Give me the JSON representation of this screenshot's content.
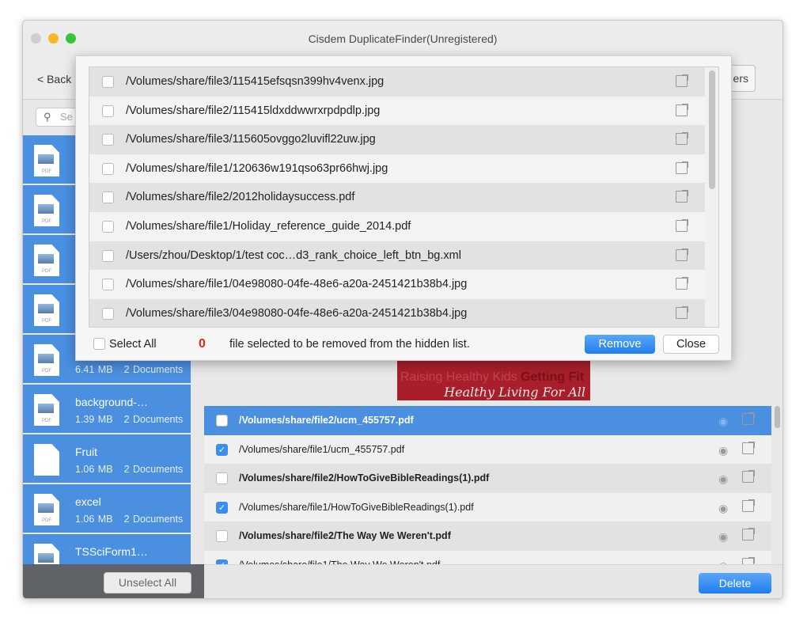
{
  "window": {
    "title": "Cisdem DuplicateFinder(Unregistered)"
  },
  "toolbar": {
    "back_label": "< Back",
    "right_button_label": "ers"
  },
  "sidebar": {
    "search_placeholder": "Se",
    "items": [
      {
        "name": "",
        "size": "",
        "count": "",
        "icon": "pdf-file-icon"
      },
      {
        "name": "",
        "size": "",
        "count": "",
        "icon": "pdf-file-icon"
      },
      {
        "name": "",
        "size": "",
        "count": "",
        "icon": "pdf-file-icon"
      },
      {
        "name": "",
        "size": "",
        "count": "",
        "icon": "pdf-file-icon"
      },
      {
        "name": "",
        "size": "6.41 MB",
        "count": "2 Documents",
        "icon": "pdf-file-icon"
      },
      {
        "name": "background-…",
        "size": "1.39 MB",
        "count": "2 Documents",
        "icon": "pdf-file-icon"
      },
      {
        "name": "Fruit",
        "size": "1.06 MB",
        "count": "2 Documents",
        "icon": "blank-file-icon"
      },
      {
        "name": "excel",
        "size": "1.06 MB",
        "count": "2 Documents",
        "icon": "pdf-file-icon"
      },
      {
        "name": "TSSciForm1…",
        "size": "",
        "count": "",
        "icon": "pdf-file-icon"
      }
    ],
    "unselect_all_label": "Unselect All"
  },
  "preview": {
    "line1_a": "Raising Healthy Kids ",
    "line1_b": "Getting Fit",
    "line2": "Healthy Living For All"
  },
  "main_list": [
    {
      "path": "/Volumes/share/file2/ucm_455757.pdf",
      "checked": false,
      "bold": true,
      "selected": true
    },
    {
      "path": "/Volumes/share/file1/ucm_455757.pdf",
      "checked": true,
      "bold": false,
      "selected": false
    },
    {
      "path": "/Volumes/share/file2/HowToGiveBibleReadings(1).pdf",
      "checked": false,
      "bold": true,
      "selected": false
    },
    {
      "path": "/Volumes/share/file1/HowToGiveBibleReadings(1).pdf",
      "checked": true,
      "bold": false,
      "selected": false
    },
    {
      "path": "/Volumes/share/file2/The Way We Weren't.pdf",
      "checked": false,
      "bold": true,
      "selected": false
    },
    {
      "path": "/Volumes/share/file1/The Way We Weren't.pdf",
      "checked": true,
      "bold": false,
      "selected": false
    }
  ],
  "delete_label": "Delete",
  "dialog": {
    "items": [
      "/Volumes/share/file3/115415efsqsn399hv4venx.jpg",
      "/Volumes/share/file2/115415ldxddwwrxrpdpdlp.jpg",
      "/Volumes/share/file3/115605ovggo2luvifl22uw.jpg",
      "/Volumes/share/file1/120636w191qso63pr66hwj.jpg",
      "/Volumes/share/file2/2012holidaysuccess.pdf",
      "/Volumes/share/file1/Holiday_reference_guide_2014.pdf",
      "/Users/zhou/Desktop/1/test coc…d3_rank_choice_left_btn_bg.xml",
      "/Volumes/share/file1/04e98080-04fe-48e6-a20a-2451421b38b4.jpg",
      "/Volumes/share/file3/04e98080-04fe-48e6-a20a-2451421b38b4.jpg"
    ],
    "select_all_label": "Select All",
    "selected_count": "0",
    "message": "file selected to be removed from the hidden list.",
    "remove_label": "Remove",
    "close_label": "Close"
  },
  "colors": {
    "accent": "#4a8fe0",
    "button_blue": "#1f7ef0",
    "count_red": "#e8231c"
  }
}
